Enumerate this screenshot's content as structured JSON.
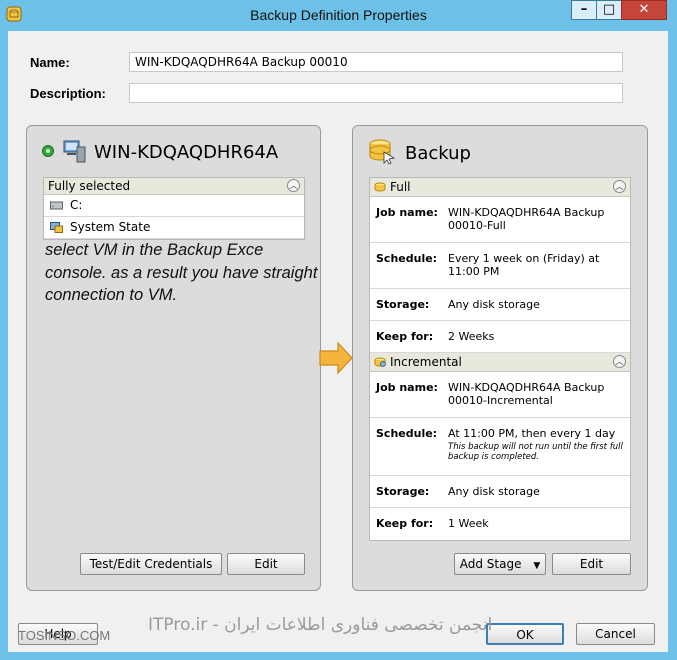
{
  "window": {
    "title": "Backup Definition Properties",
    "minimize": "–",
    "maximize": "□",
    "close": "✕"
  },
  "form": {
    "name_label": "Name:",
    "name_value": "WIN-KDQAQDHR64A Backup 00010",
    "description_label": "Description:",
    "description_value": ""
  },
  "source": {
    "title": "WIN-KDQAQDHR64A",
    "header": "Fully selected",
    "items": [
      {
        "label": "C:",
        "icon": "drive-icon"
      },
      {
        "label": "System State",
        "icon": "system-state-icon"
      }
    ],
    "annotation": "select VM in the Backup Exce console. as a result you have straight connection to VM.",
    "test_edit_label": "Test/Edit Credentials",
    "edit_label": "Edit"
  },
  "backup": {
    "title": "Backup",
    "stages": [
      {
        "name": "Full",
        "rows": [
          {
            "label": "Job name:",
            "value": "WIN-KDQAQDHR64A Backup 00010-Full"
          },
          {
            "label": "Schedule:",
            "value": "Every 1 week on (Friday) at 11:00 PM"
          },
          {
            "label": "Storage:",
            "value": "Any disk storage"
          },
          {
            "label": "Keep for:",
            "value": "2 Weeks"
          }
        ]
      },
      {
        "name": "Incremental",
        "rows": [
          {
            "label": "Job name:",
            "value": "WIN-KDQAQDHR64A Backup 00010-Incremental"
          },
          {
            "label": "Schedule:",
            "value": "At 11:00 PM, then every 1 day",
            "note": "This backup will not run until the first full backup is completed."
          },
          {
            "label": "Storage:",
            "value": "Any disk storage"
          },
          {
            "label": "Keep for:",
            "value": "1 Week"
          }
        ]
      }
    ],
    "add_stage_label": "Add Stage",
    "edit_label": "Edit"
  },
  "footer": {
    "help_label": "Help",
    "ok_label": "OK",
    "cancel_label": "Cancel"
  },
  "watermarks": {
    "center": "ITPro.ir - انجمن تخصصی فناوری اطلاعات ایران",
    "left": "TOSINSO.COM"
  },
  "colors": {
    "window_frame": "#6dc0e8",
    "close_button": "#c6453b",
    "arrow": "#f5b43c",
    "status_green": "#2fa83a"
  }
}
